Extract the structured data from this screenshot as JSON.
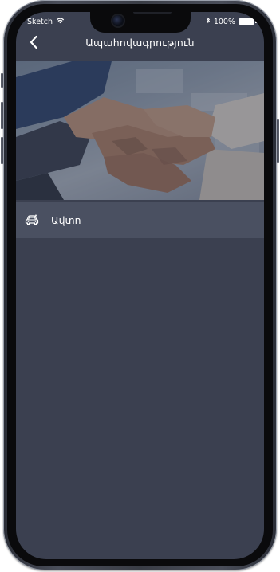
{
  "status_bar": {
    "carrier": "Sketch",
    "battery": "100%",
    "wifi_icon": "wifi-icon",
    "bluetooth_icon": "bluetooth-icon"
  },
  "nav": {
    "title": "Ապահովագրություն",
    "back_icon": "chevron-left-icon"
  },
  "hero": {
    "image": "teamwork-hands-photo"
  },
  "list": {
    "items": [
      {
        "label": "Ավտո",
        "icon": "car-icon"
      }
    ]
  },
  "colors": {
    "background": "#3b4050",
    "list_item": "#4a5061",
    "text": "#ffffff"
  }
}
